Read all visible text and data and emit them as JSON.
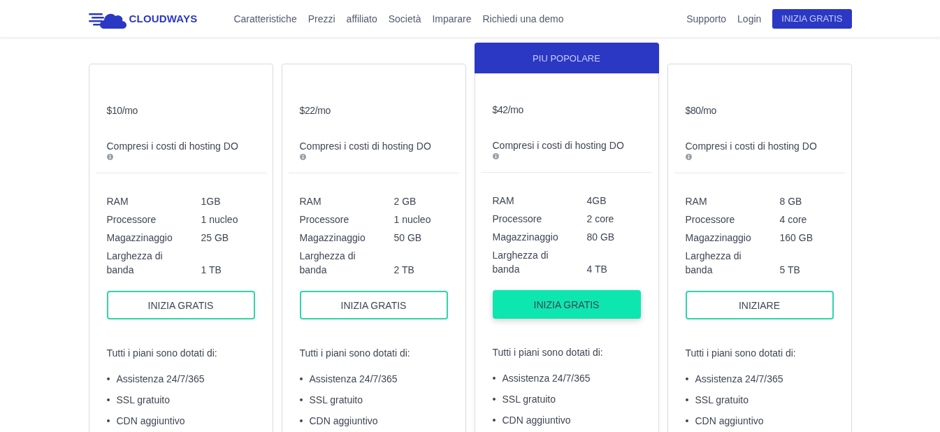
{
  "header": {
    "logo_text": "CLOUDWAYS",
    "nav": [
      "Caratteristiche",
      "Prezzi",
      "affiliato",
      "Società",
      "Imparare",
      "Richiedi una demo"
    ],
    "right_links": [
      "Supporto",
      "Login"
    ],
    "cta": "INIZIA GRATIS"
  },
  "plans": [
    {
      "popular": false,
      "price": "$10/mo",
      "note": "Compresi i costi di hosting DO",
      "specs": [
        {
          "label": "RAM",
          "value": "1GB"
        },
        {
          "label": "Processore",
          "value": "1 nucleo"
        },
        {
          "label": "Magazzinaggio",
          "value": "25 GB"
        },
        {
          "label": "Larghezza di banda",
          "value": "1 TB"
        }
      ],
      "button": {
        "label": "INIZIA GRATIS",
        "kind": "outline"
      },
      "features_title": "Tutti i piani sono dotati di:",
      "features": [
        "Assistenza 24/7/365",
        "SSL gratuito",
        "CDN aggiuntivo"
      ]
    },
    {
      "popular": false,
      "price": "$22/mo",
      "note": "Compresi i costi di hosting DO",
      "specs": [
        {
          "label": "RAM",
          "value": "2 GB"
        },
        {
          "label": "Processore",
          "value": "1 nucleo"
        },
        {
          "label": "Magazzinaggio",
          "value": "50 GB"
        },
        {
          "label": "Larghezza di banda",
          "value": "2 TB"
        }
      ],
      "button": {
        "label": "INIZIA GRATIS",
        "kind": "outline"
      },
      "features_title": "Tutti i piani sono dotati di:",
      "features": [
        "Assistenza 24/7/365",
        "SSL gratuito",
        "CDN aggiuntivo"
      ]
    },
    {
      "popular": true,
      "badge": "PIU POPOLARE",
      "price": "$42/mo",
      "note": "Compresi i costi di hosting DO",
      "specs": [
        {
          "label": "RAM",
          "value": "4GB"
        },
        {
          "label": "Processore",
          "value": "2 core"
        },
        {
          "label": "Magazzinaggio",
          "value": "80 GB"
        },
        {
          "label": "Larghezza di banda",
          "value": "4 TB"
        }
      ],
      "button": {
        "label": "INIZIA GRATIS",
        "kind": "filled"
      },
      "features_title": "Tutti i piani sono dotati di:",
      "features": [
        "Assistenza 24/7/365",
        "SSL gratuito",
        "CDN aggiuntivo"
      ]
    },
    {
      "popular": false,
      "price": "$80/mo",
      "note": "Compresi i costi di hosting DO",
      "specs": [
        {
          "label": "RAM",
          "value": "8 GB"
        },
        {
          "label": "Processore",
          "value": "4 core"
        },
        {
          "label": "Magazzinaggio",
          "value": "160 GB"
        },
        {
          "label": "Larghezza di banda",
          "value": "5 TB"
        }
      ],
      "button": {
        "label": "INIZIARE",
        "kind": "outline"
      },
      "features_title": "Tutti i piani sono dotati di:",
      "features": [
        "Assistenza 24/7/365",
        "SSL gratuito",
        "CDN aggiuntivo"
      ]
    }
  ]
}
